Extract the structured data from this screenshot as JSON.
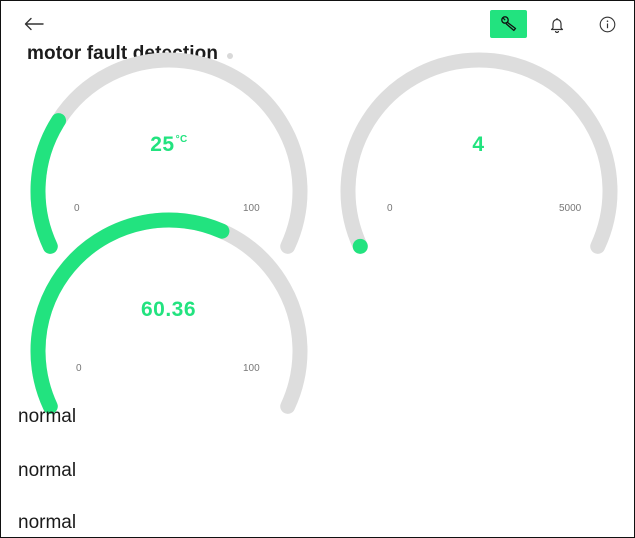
{
  "colors": {
    "accent": "#22e37f",
    "track": "#dddddd",
    "text": "#1c1c1c"
  },
  "header": {
    "back_icon": "arrow-left-icon",
    "tool_icon": "wrench-icon",
    "bell_icon": "bell-icon",
    "info_icon": "info-icon"
  },
  "title": "motor fault detection",
  "gauges": [
    {
      "id": "gauge-1",
      "value": 25,
      "display": "25",
      "unit": "°C",
      "min": 0,
      "max": 100,
      "min_label": "0",
      "max_label": "100"
    },
    {
      "id": "gauge-2",
      "value": 4,
      "display": "4",
      "unit": "",
      "min": 0,
      "max": 5000,
      "min_label": "0",
      "max_label": "5000"
    },
    {
      "id": "gauge-3",
      "value": 60.36,
      "display": "60.36",
      "unit": "",
      "min": 0,
      "max": 100,
      "min_label": "0",
      "max_label": "100"
    }
  ],
  "status_labels": [
    "normal",
    "normal",
    "normal"
  ]
}
